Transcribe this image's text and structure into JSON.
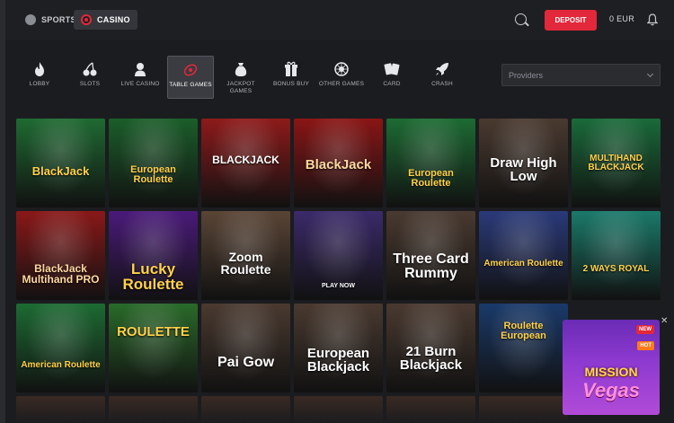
{
  "header": {
    "sports_label": "SPORTS",
    "casino_label": "CASINO",
    "deposit_label": "DEPOSIT",
    "balance": "0 EUR"
  },
  "categories": [
    {
      "label": "LOBBY",
      "icon": "flame-icon"
    },
    {
      "label": "SLOTS",
      "icon": "cherries-icon"
    },
    {
      "label": "LIVE CASINO",
      "icon": "dealer-icon"
    },
    {
      "label": "TABLE GAMES",
      "icon": "table-games-icon",
      "active": true
    },
    {
      "label": "JACKPOT GAMES",
      "icon": "money-bag-icon"
    },
    {
      "label": "BONUS BUY",
      "icon": "gift-icon"
    },
    {
      "label": "OTHER GAMES",
      "icon": "roulette-wheel-icon"
    },
    {
      "label": "CARD",
      "icon": "cards-icon"
    },
    {
      "label": "CRASH",
      "icon": "rocket-icon"
    }
  ],
  "providers_placeholder": "Providers",
  "games": [
    {
      "title": "BlackJack",
      "bg": "#1f6a32",
      "fg": "#ffd24a"
    },
    {
      "title": "European Roulette",
      "bg": "#1b5e2a",
      "fg": "#ffd24a"
    },
    {
      "title": "BLACKJACK",
      "bg": "#8e1a1a",
      "fg": "#ffffff"
    },
    {
      "title": "BlackJack",
      "bg": "#8a1515",
      "fg": "#ffd8a0"
    },
    {
      "title": "European Roulette",
      "bg": "#1d6b33",
      "fg": "#ffd24a"
    },
    {
      "title": "Draw High Low",
      "bg": "#4a3a30",
      "fg": "#ffffff"
    },
    {
      "title": "MULTIHAND BLACKJACK",
      "bg": "#1a6a3a",
      "fg": "#ffd24a"
    },
    {
      "title": "BlackJack Multihand PRO",
      "bg": "#8a1818",
      "fg": "#ffd8a0"
    },
    {
      "title": "Lucky Roulette",
      "bg": "#4a1a7a",
      "fg": "#ffd24a"
    },
    {
      "title": "Zoom Roulette",
      "bg": "#5a4536",
      "fg": "#ffffff"
    },
    {
      "title": "PLAY NOW",
      "bg": "#3b2a6a",
      "fg": "#ffffff"
    },
    {
      "title": "Three Card Rummy",
      "bg": "#4a3a30",
      "fg": "#ffffff"
    },
    {
      "title": "American Roulette",
      "bg": "#2a3a7a",
      "fg": "#ffd24a"
    },
    {
      "title": "2 WAYS ROYAL",
      "bg": "#1a7a6a",
      "fg": "#ffd24a"
    },
    {
      "title": "American Roulette",
      "bg": "#1d6b33",
      "fg": "#ffd24a"
    },
    {
      "title": "ROULETTE",
      "bg": "#2a6a2a",
      "fg": "#ffd24a"
    },
    {
      "title": "Pai Gow",
      "bg": "#4a3a30",
      "fg": "#ffffff"
    },
    {
      "title": "European Blackjack",
      "bg": "#4a3a30",
      "fg": "#ffffff"
    },
    {
      "title": "21 Burn Blackjack",
      "bg": "#4a3a30",
      "fg": "#ffffff"
    },
    {
      "title": "Roulette European",
      "bg": "#1a3a6a",
      "fg": "#ffd24a"
    }
  ],
  "promo": {
    "badge_new": "NEW",
    "badge_hot": "HOT",
    "title_top": "MISSION",
    "title_bottom": "Vegas"
  },
  "close_label": "✕"
}
